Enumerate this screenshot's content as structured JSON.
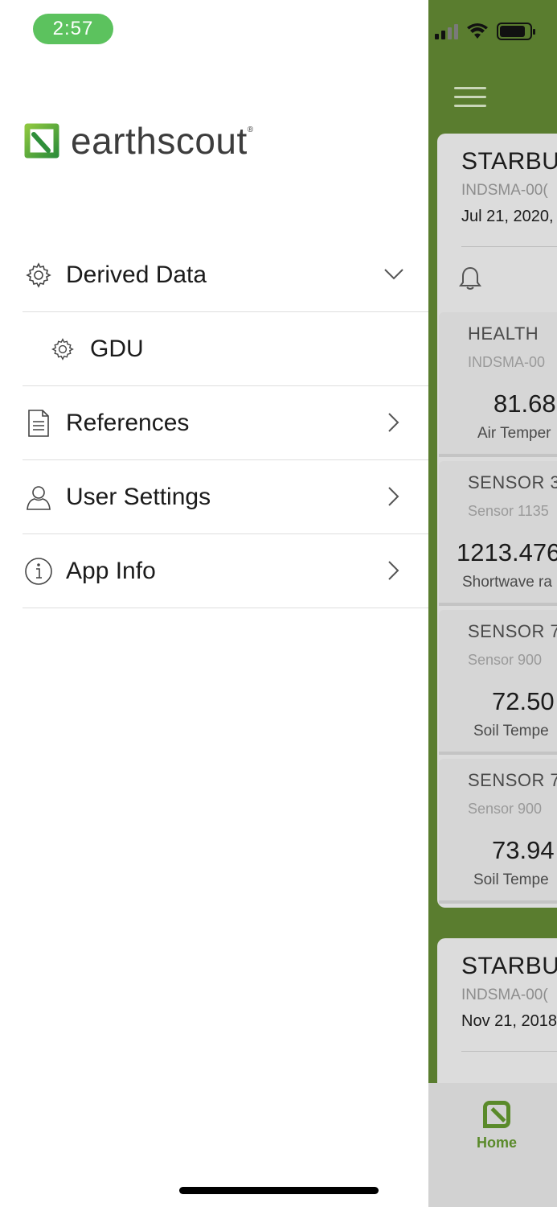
{
  "status_bar": {
    "time": "2:57"
  },
  "brand": {
    "name": "earthscout",
    "registered": "®",
    "color": "#5a8a2a"
  },
  "drawer_menu": {
    "items": [
      {
        "label": "Derived Data",
        "icon": "gear-icon",
        "expanded": true
      },
      {
        "label": "GDU",
        "icon": "gear-icon",
        "sub": true
      },
      {
        "label": "References",
        "icon": "document-icon"
      },
      {
        "label": "User Settings",
        "icon": "user-icon"
      },
      {
        "label": "App Info",
        "icon": "info-icon"
      }
    ]
  },
  "background": {
    "cards": [
      {
        "title": "STARBU",
        "subtitle": "INDSMA-00(",
        "date": "Jul 21, 2020,",
        "sensors": [
          {
            "title": "HEALTH",
            "subtitle": "INDSMA-00",
            "value": "81.68",
            "label": "Air Temper"
          },
          {
            "title": "SENSOR 3",
            "subtitle": "Sensor 1135",
            "value": "1213.476",
            "label": "Shortwave ra"
          },
          {
            "title": "SENSOR 7",
            "subtitle": "Sensor 900",
            "value": "72.50",
            "label": "Soil Tempe"
          },
          {
            "title": "SENSOR 7",
            "subtitle": "Sensor 900",
            "value": "73.94",
            "label": "Soil Tempe"
          }
        ]
      },
      {
        "title": "STARBU",
        "subtitle": "INDSMA-00(",
        "date": "Nov 21, 2018"
      }
    ],
    "tab": {
      "label": "Home",
      "icon": "home-icon"
    }
  }
}
